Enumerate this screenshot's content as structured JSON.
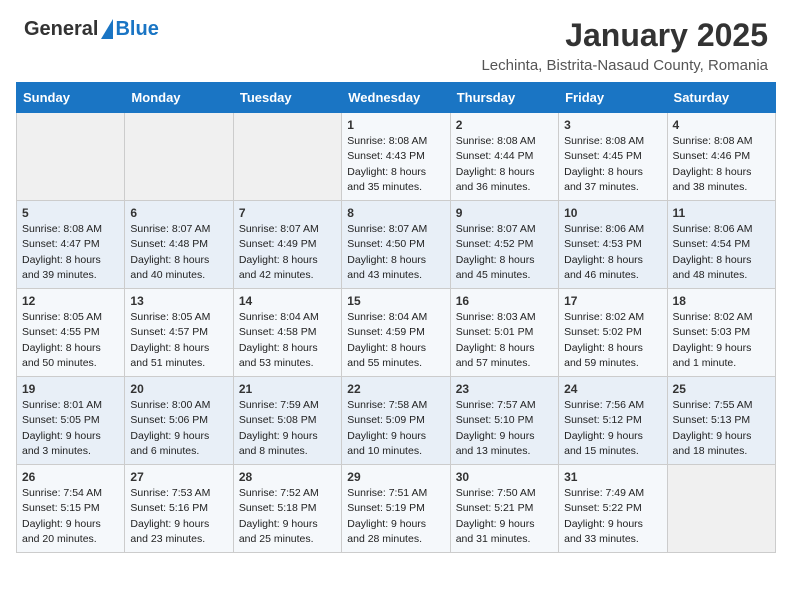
{
  "logo": {
    "general": "General",
    "blue": "Blue"
  },
  "title": "January 2025",
  "location": "Lechinta, Bistrita-Nasaud County, Romania",
  "days_of_week": [
    "Sunday",
    "Monday",
    "Tuesday",
    "Wednesday",
    "Thursday",
    "Friday",
    "Saturday"
  ],
  "weeks": [
    [
      {
        "day": "",
        "info": ""
      },
      {
        "day": "",
        "info": ""
      },
      {
        "day": "",
        "info": ""
      },
      {
        "day": "1",
        "info": "Sunrise: 8:08 AM\nSunset: 4:43 PM\nDaylight: 8 hours\nand 35 minutes."
      },
      {
        "day": "2",
        "info": "Sunrise: 8:08 AM\nSunset: 4:44 PM\nDaylight: 8 hours\nand 36 minutes."
      },
      {
        "day": "3",
        "info": "Sunrise: 8:08 AM\nSunset: 4:45 PM\nDaylight: 8 hours\nand 37 minutes."
      },
      {
        "day": "4",
        "info": "Sunrise: 8:08 AM\nSunset: 4:46 PM\nDaylight: 8 hours\nand 38 minutes."
      }
    ],
    [
      {
        "day": "5",
        "info": "Sunrise: 8:08 AM\nSunset: 4:47 PM\nDaylight: 8 hours\nand 39 minutes."
      },
      {
        "day": "6",
        "info": "Sunrise: 8:07 AM\nSunset: 4:48 PM\nDaylight: 8 hours\nand 40 minutes."
      },
      {
        "day": "7",
        "info": "Sunrise: 8:07 AM\nSunset: 4:49 PM\nDaylight: 8 hours\nand 42 minutes."
      },
      {
        "day": "8",
        "info": "Sunrise: 8:07 AM\nSunset: 4:50 PM\nDaylight: 8 hours\nand 43 minutes."
      },
      {
        "day": "9",
        "info": "Sunrise: 8:07 AM\nSunset: 4:52 PM\nDaylight: 8 hours\nand 45 minutes."
      },
      {
        "day": "10",
        "info": "Sunrise: 8:06 AM\nSunset: 4:53 PM\nDaylight: 8 hours\nand 46 minutes."
      },
      {
        "day": "11",
        "info": "Sunrise: 8:06 AM\nSunset: 4:54 PM\nDaylight: 8 hours\nand 48 minutes."
      }
    ],
    [
      {
        "day": "12",
        "info": "Sunrise: 8:05 AM\nSunset: 4:55 PM\nDaylight: 8 hours\nand 50 minutes."
      },
      {
        "day": "13",
        "info": "Sunrise: 8:05 AM\nSunset: 4:57 PM\nDaylight: 8 hours\nand 51 minutes."
      },
      {
        "day": "14",
        "info": "Sunrise: 8:04 AM\nSunset: 4:58 PM\nDaylight: 8 hours\nand 53 minutes."
      },
      {
        "day": "15",
        "info": "Sunrise: 8:04 AM\nSunset: 4:59 PM\nDaylight: 8 hours\nand 55 minutes."
      },
      {
        "day": "16",
        "info": "Sunrise: 8:03 AM\nSunset: 5:01 PM\nDaylight: 8 hours\nand 57 minutes."
      },
      {
        "day": "17",
        "info": "Sunrise: 8:02 AM\nSunset: 5:02 PM\nDaylight: 8 hours\nand 59 minutes."
      },
      {
        "day": "18",
        "info": "Sunrise: 8:02 AM\nSunset: 5:03 PM\nDaylight: 9 hours\nand 1 minute."
      }
    ],
    [
      {
        "day": "19",
        "info": "Sunrise: 8:01 AM\nSunset: 5:05 PM\nDaylight: 9 hours\nand 3 minutes."
      },
      {
        "day": "20",
        "info": "Sunrise: 8:00 AM\nSunset: 5:06 PM\nDaylight: 9 hours\nand 6 minutes."
      },
      {
        "day": "21",
        "info": "Sunrise: 7:59 AM\nSunset: 5:08 PM\nDaylight: 9 hours\nand 8 minutes."
      },
      {
        "day": "22",
        "info": "Sunrise: 7:58 AM\nSunset: 5:09 PM\nDaylight: 9 hours\nand 10 minutes."
      },
      {
        "day": "23",
        "info": "Sunrise: 7:57 AM\nSunset: 5:10 PM\nDaylight: 9 hours\nand 13 minutes."
      },
      {
        "day": "24",
        "info": "Sunrise: 7:56 AM\nSunset: 5:12 PM\nDaylight: 9 hours\nand 15 minutes."
      },
      {
        "day": "25",
        "info": "Sunrise: 7:55 AM\nSunset: 5:13 PM\nDaylight: 9 hours\nand 18 minutes."
      }
    ],
    [
      {
        "day": "26",
        "info": "Sunrise: 7:54 AM\nSunset: 5:15 PM\nDaylight: 9 hours\nand 20 minutes."
      },
      {
        "day": "27",
        "info": "Sunrise: 7:53 AM\nSunset: 5:16 PM\nDaylight: 9 hours\nand 23 minutes."
      },
      {
        "day": "28",
        "info": "Sunrise: 7:52 AM\nSunset: 5:18 PM\nDaylight: 9 hours\nand 25 minutes."
      },
      {
        "day": "29",
        "info": "Sunrise: 7:51 AM\nSunset: 5:19 PM\nDaylight: 9 hours\nand 28 minutes."
      },
      {
        "day": "30",
        "info": "Sunrise: 7:50 AM\nSunset: 5:21 PM\nDaylight: 9 hours\nand 31 minutes."
      },
      {
        "day": "31",
        "info": "Sunrise: 7:49 AM\nSunset: 5:22 PM\nDaylight: 9 hours\nand 33 minutes."
      },
      {
        "day": "",
        "info": ""
      }
    ]
  ]
}
